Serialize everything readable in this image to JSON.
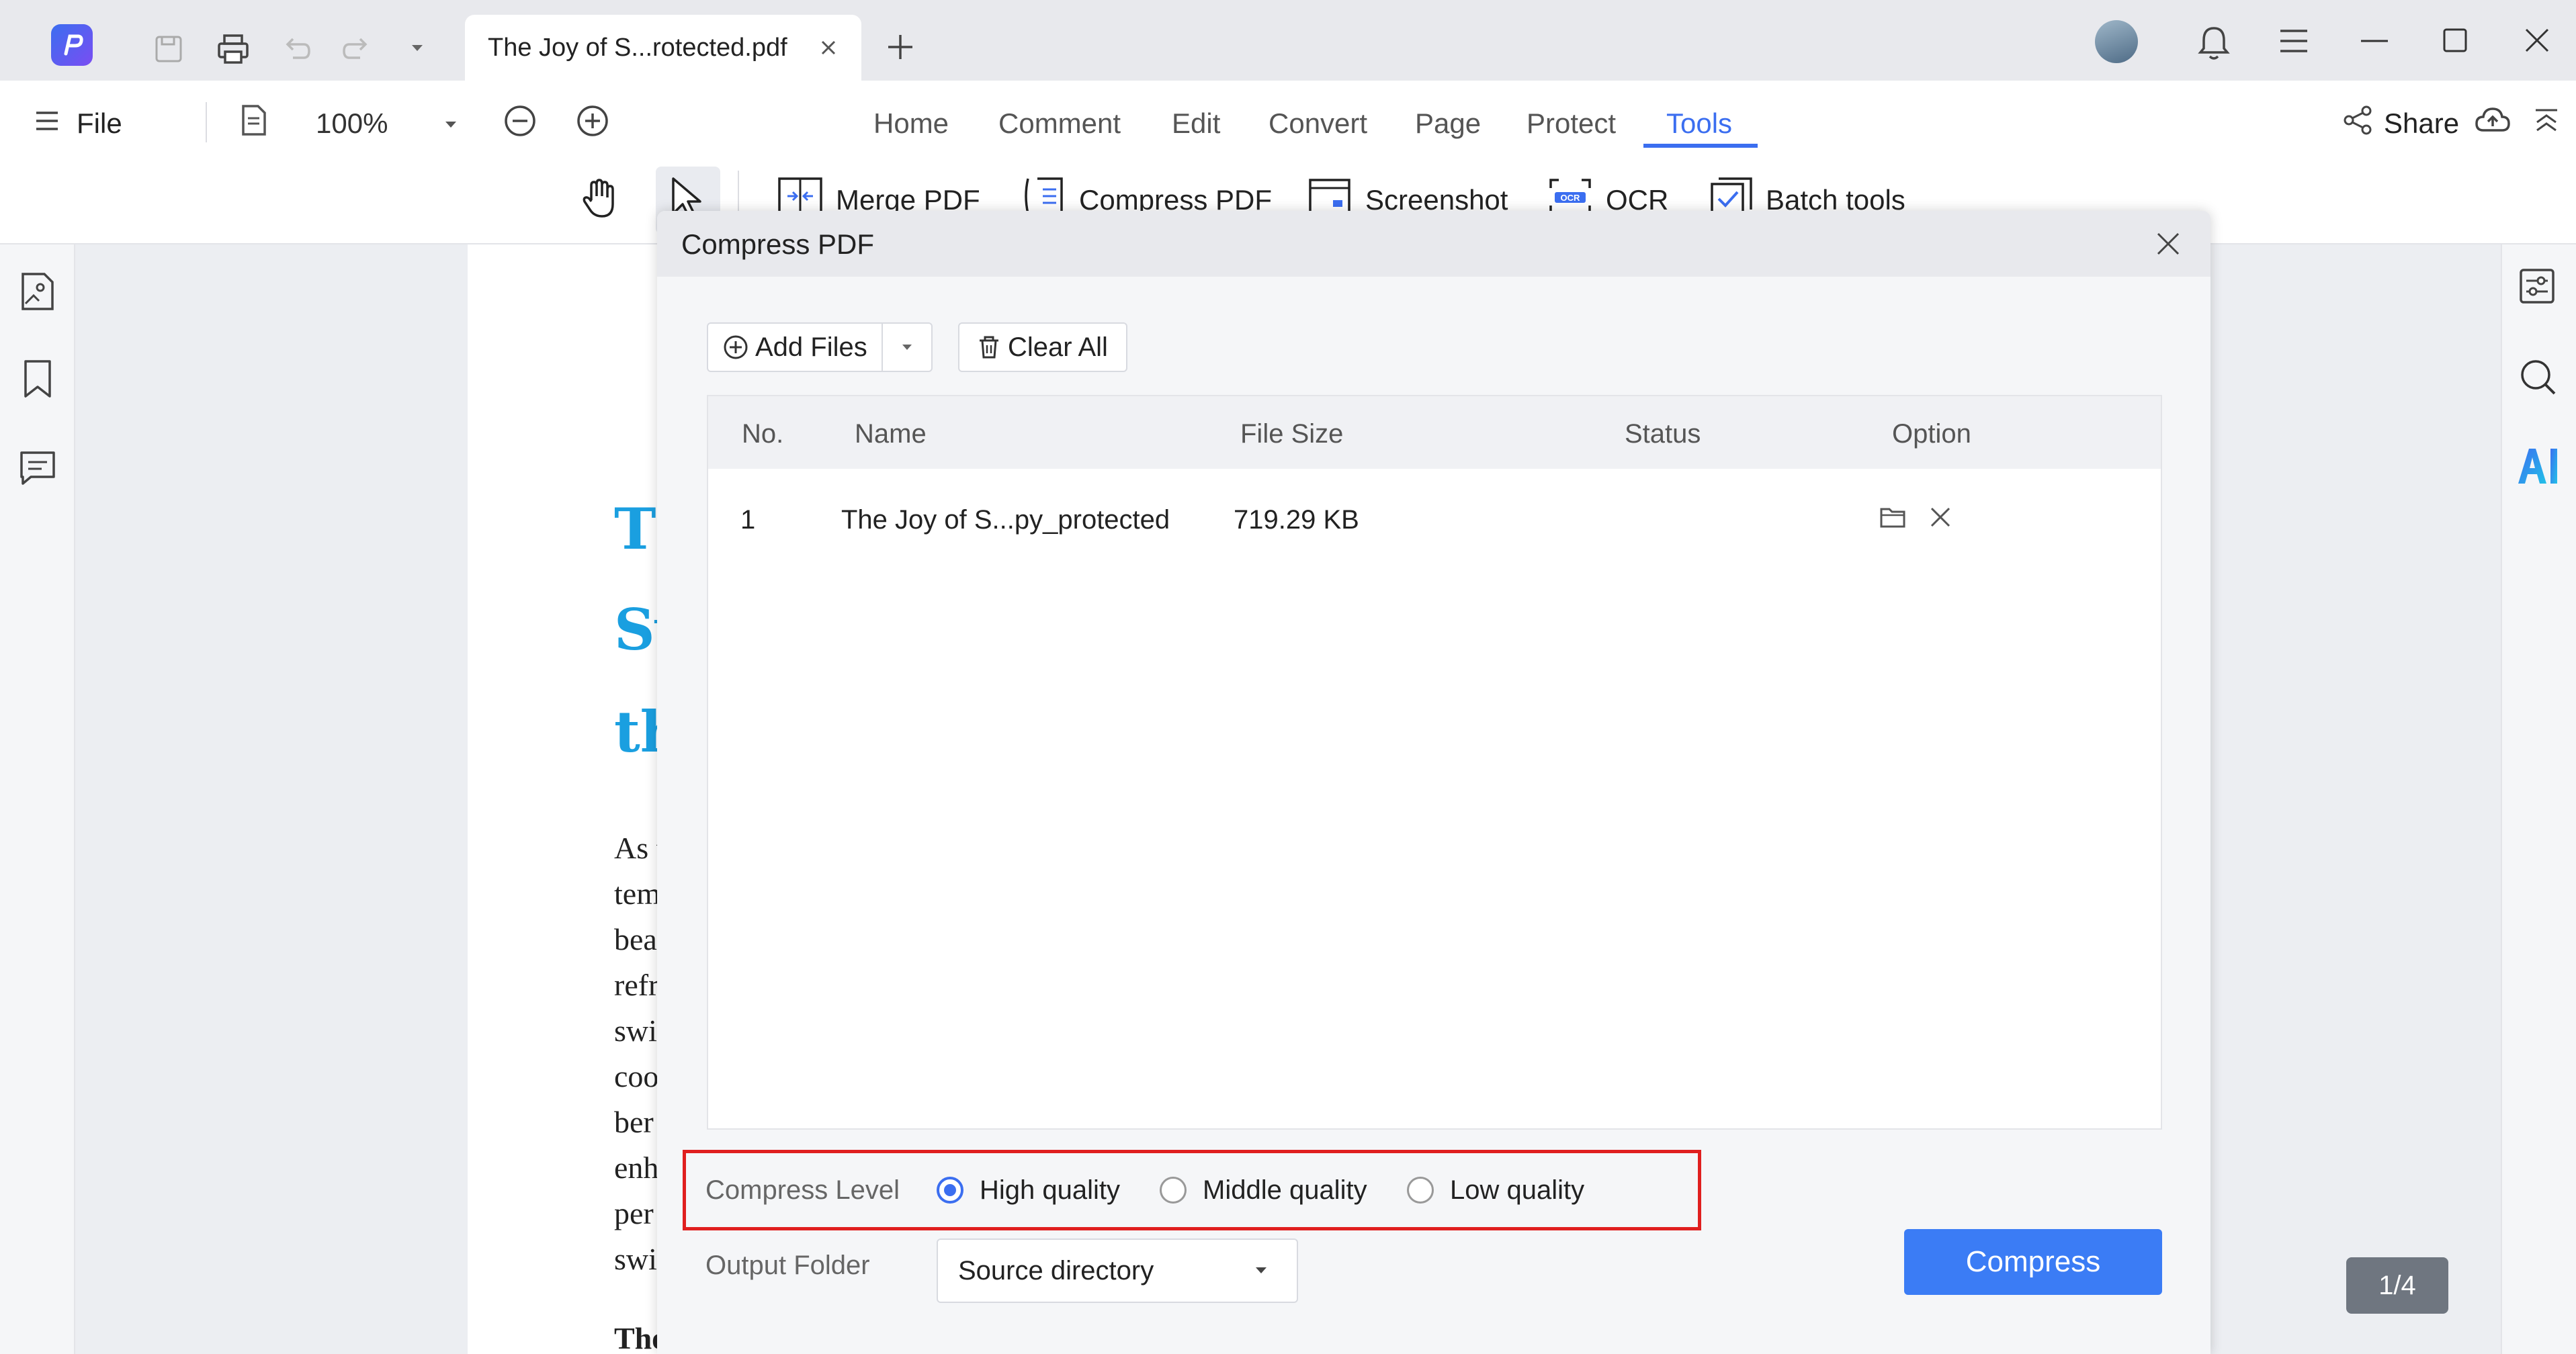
{
  "window": {
    "tab_title": "The Joy of S...rotected.pdf"
  },
  "menubar": {
    "file_label": "File",
    "zoom": "100%",
    "tabs": [
      "Home",
      "Comment",
      "Edit",
      "Convert",
      "Page",
      "Protect",
      "Tools"
    ],
    "active_tab": "Tools",
    "share_label": "Share"
  },
  "tools": {
    "items": [
      "Merge PDF",
      "Compress PDF",
      "Screenshot",
      "OCR",
      "Batch tools"
    ]
  },
  "document": {
    "headings": [
      "Th",
      "Sw",
      "th"
    ],
    "lines": [
      "As t",
      "tem",
      "bea",
      "refr",
      "swi",
      "coo",
      "ber",
      "enh",
      "per",
      "swi",
      "The"
    ]
  },
  "dialog": {
    "title": "Compress PDF",
    "add_files_label": "Add Files",
    "clear_all_label": "Clear All",
    "columns": [
      "No.",
      "Name",
      "File Size",
      "Status",
      "Option"
    ],
    "rows": [
      {
        "no": "1",
        "name": "The Joy of S...py_protected",
        "size": "719.29 KB",
        "status": ""
      }
    ],
    "compress_level_label": "Compress Level",
    "levels": [
      "High quality",
      "Middle quality",
      "Low quality"
    ],
    "selected_level": "High quality",
    "output_folder_label": "Output Folder",
    "output_folder_value": "Source directory",
    "compress_button": "Compress"
  },
  "status": {
    "page_indicator": "1/4"
  },
  "colors": {
    "accent": "#3b6ef0",
    "compress_button": "#3b7cf5",
    "highlight_box": "#e01f1f",
    "heading_blue": "#1a9fe0",
    "ai_gradient_start": "#3b6ef0",
    "ai_gradient_end": "#22c0e8"
  }
}
